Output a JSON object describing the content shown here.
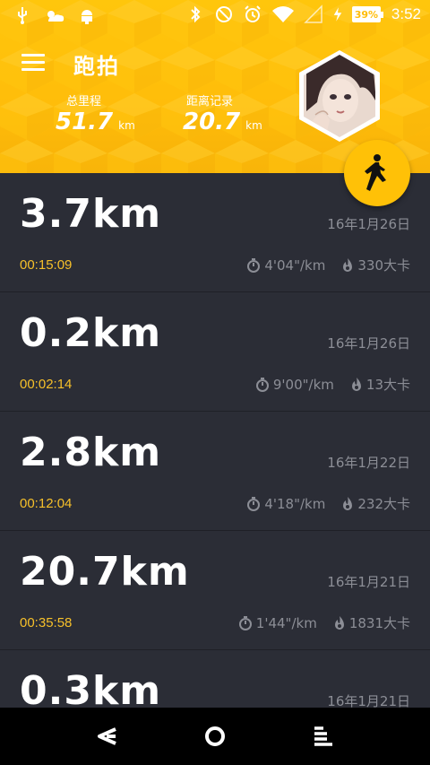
{
  "status_bar": {
    "time": "3:52",
    "battery": "39%",
    "icons": [
      "usb-icon",
      "weather-icon",
      "android-icon",
      "bluetooth-icon",
      "dnd-icon",
      "alarm-icon",
      "wifi-icon",
      "signal-icon",
      "charging-icon"
    ]
  },
  "header": {
    "title": "跑拍",
    "total_label": "总里程",
    "total_value": "51.7",
    "total_unit": "km",
    "record_label": "距离记录",
    "record_value": "20.7",
    "record_unit": "km",
    "accent_color": "#ffbd0a"
  },
  "runs": [
    {
      "distance": "3.7km",
      "date": "16年1月26日",
      "duration": "00:15:09",
      "pace": "4'04\"/km",
      "calories": "330大卡"
    },
    {
      "distance": "0.2km",
      "date": "16年1月26日",
      "duration": "00:02:14",
      "pace": "9'00\"/km",
      "calories": "13大卡"
    },
    {
      "distance": "2.8km",
      "date": "16年1月22日",
      "duration": "00:12:04",
      "pace": "4'18\"/km",
      "calories": "232大卡"
    },
    {
      "distance": "20.7km",
      "date": "16年1月21日",
      "duration": "00:35:58",
      "pace": "1'44\"/km",
      "calories": "1831大卡"
    },
    {
      "distance": "0.3km",
      "date": "16年1月21日",
      "duration": "",
      "pace": "",
      "calories": ""
    }
  ],
  "navigation": {
    "back": "back-icon",
    "home": "home-icon",
    "recents": "recents-icon"
  }
}
